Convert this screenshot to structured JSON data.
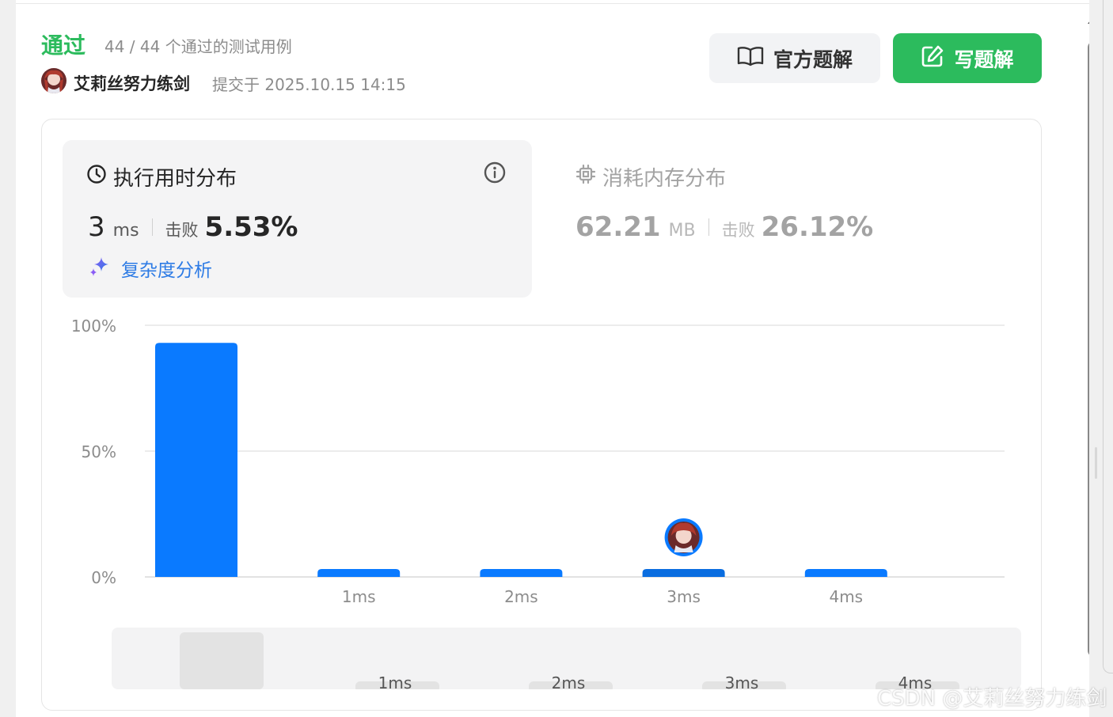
{
  "header": {
    "status": "通过",
    "test_count": "44 / 44 个通过的测试用例",
    "username": "艾莉丝努力练剑",
    "submitted": "提交于 2025.10.15 14:15",
    "official_solution_label": "官方题解",
    "write_solution_label": "写题解"
  },
  "runtime": {
    "title": "执行用时分布",
    "value": "3",
    "unit": "ms",
    "beat_label": "击败",
    "beat_pct": "5.53%",
    "complexity_label": "复杂度分析"
  },
  "memory": {
    "title": "消耗内存分布",
    "value": "62.21",
    "unit": "MB",
    "beat_label": "击败",
    "beat_pct": "26.12%"
  },
  "chart_data": {
    "type": "bar",
    "title": "",
    "xlabel": "",
    "ylabel": "",
    "ylim": [
      0,
      100
    ],
    "y_ticks": [
      "100%",
      "50%",
      "0%"
    ],
    "y_tick_values": [
      100,
      50,
      0
    ],
    "categories": [
      "",
      "1ms",
      "2ms",
      "3ms",
      "4ms"
    ],
    "values": [
      93,
      3,
      3,
      3,
      3
    ],
    "highlight_index": 3,
    "bar_color": "#0a7aff",
    "highlight_color": "#0a6de0",
    "grid": true,
    "brush": {
      "categories": [
        "",
        "1ms",
        "2ms",
        "3ms",
        "4ms"
      ]
    }
  },
  "colors": {
    "accent_green": "#2cbb5d",
    "bar_blue": "#0a7aff",
    "link_blue": "#2d7be5"
  },
  "watermark": "CSDN @艾莉丝努力练剑"
}
